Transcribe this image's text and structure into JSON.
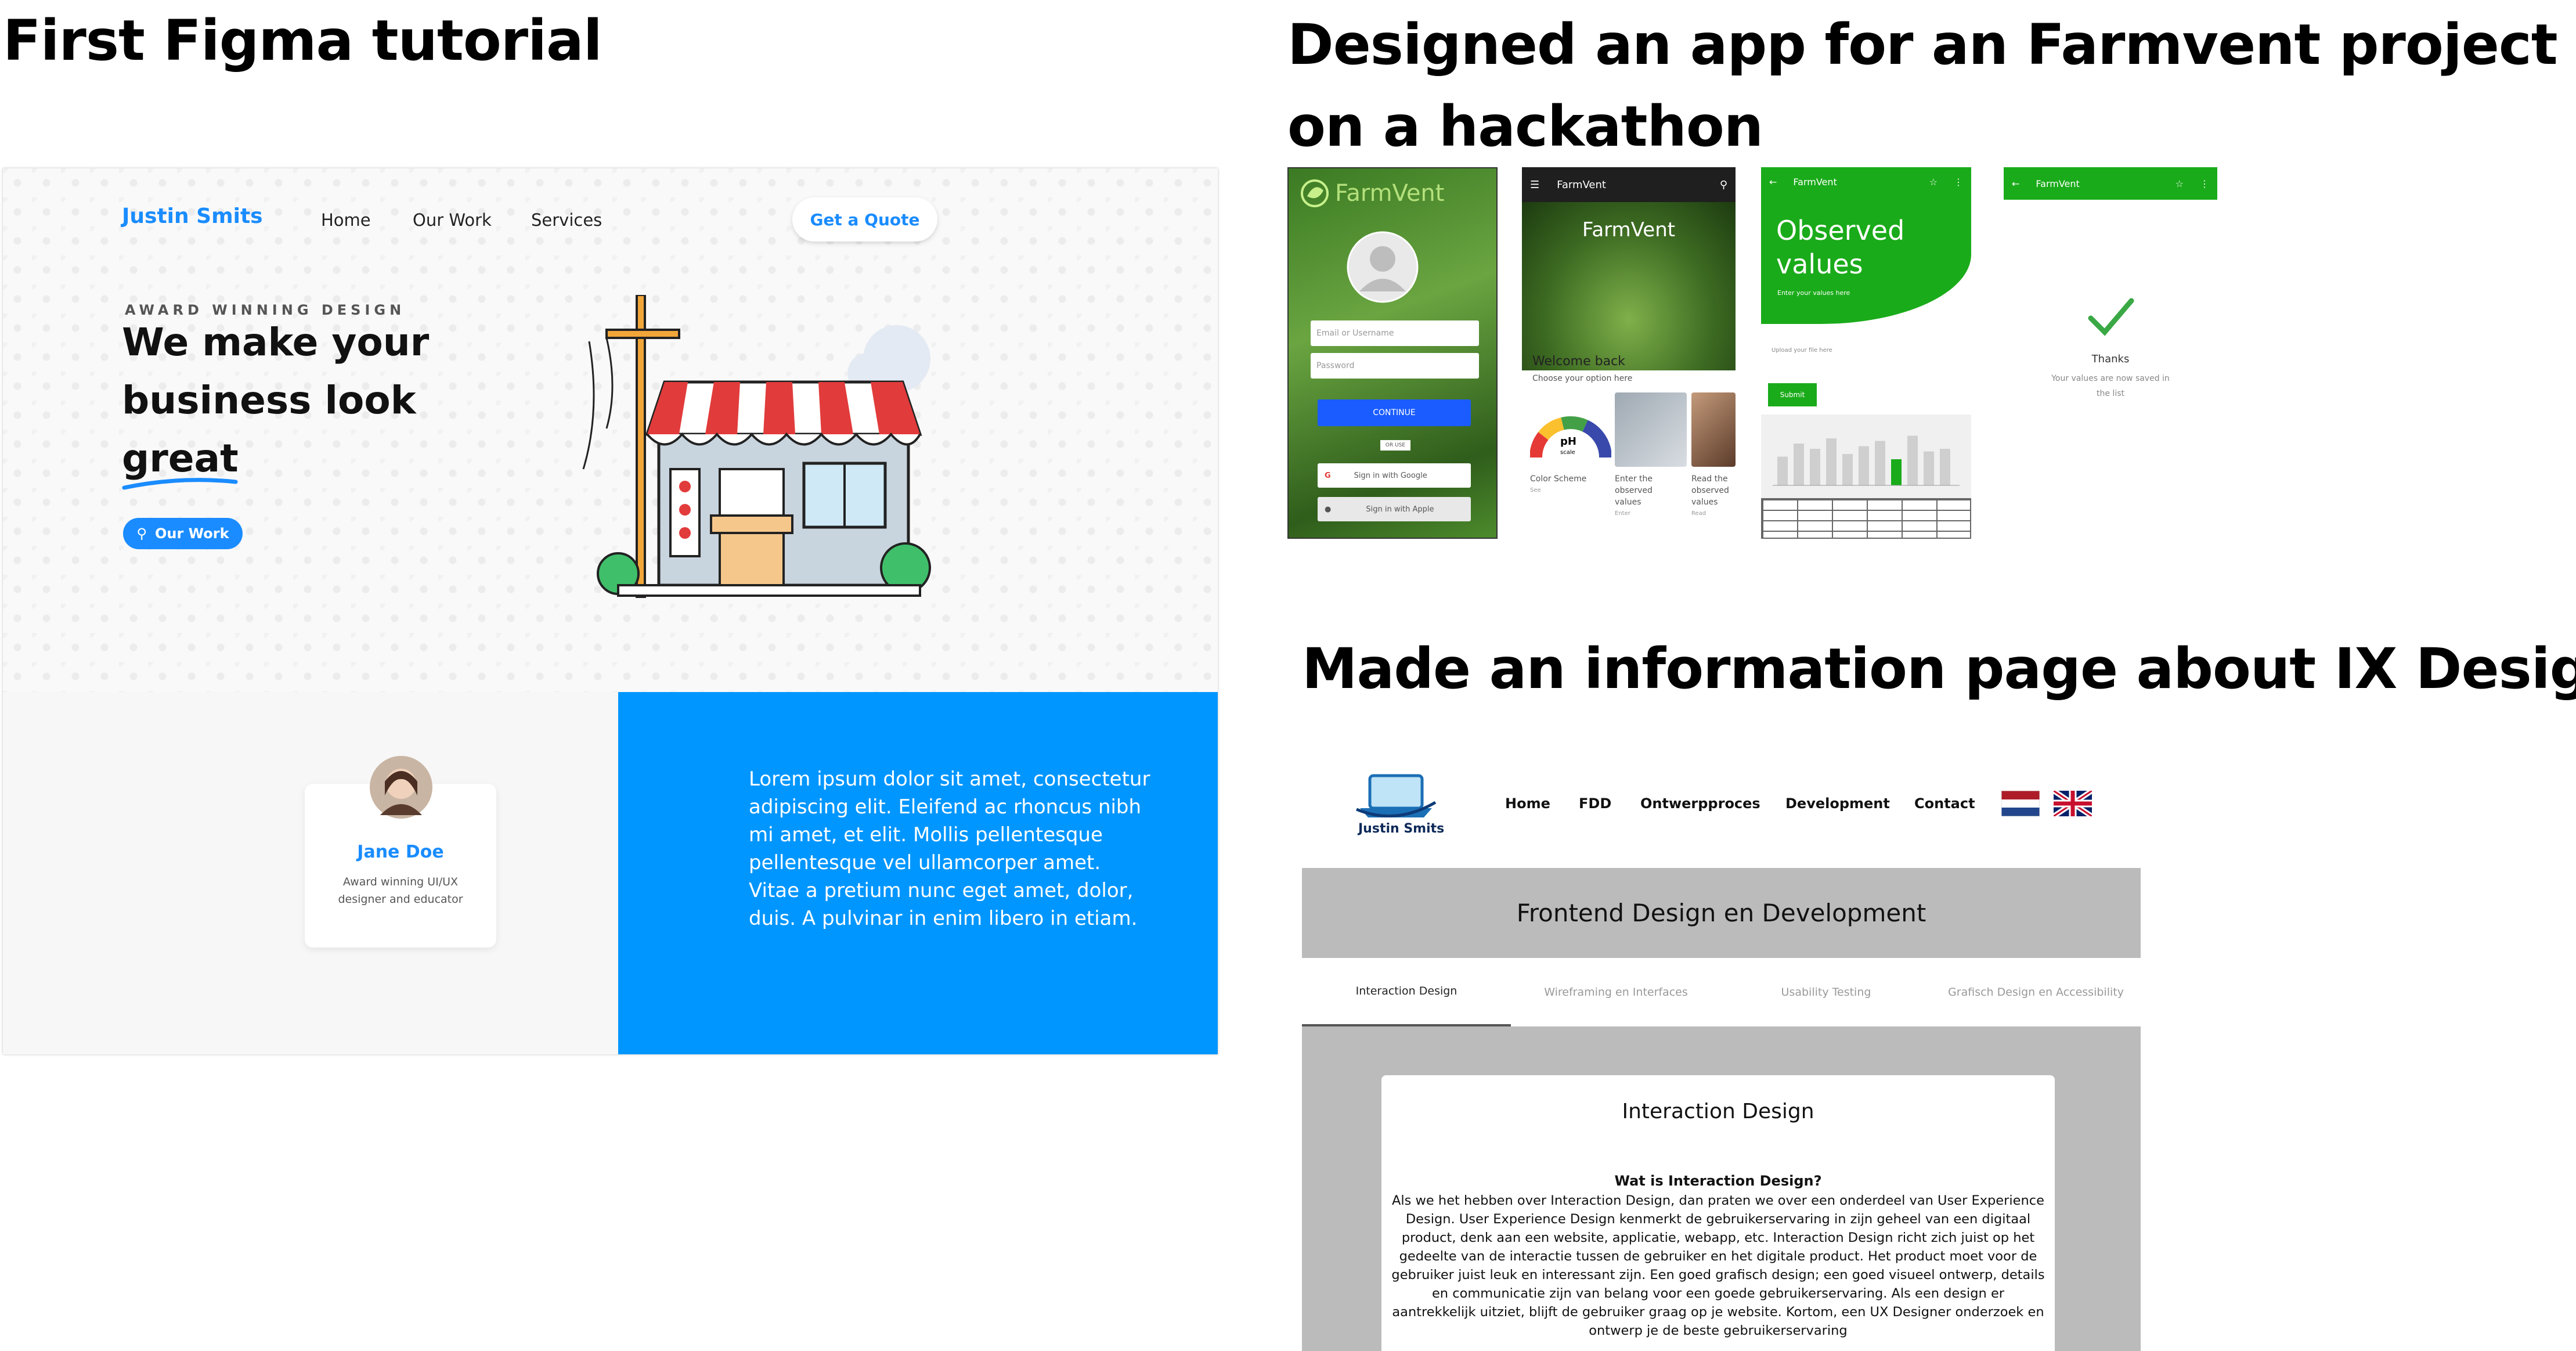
{
  "headings": {
    "figma": "First Figma tutorial",
    "farmvent_line1": "Designed an app for an Farmvent project",
    "farmvent_line2": "on a hackathon",
    "ix": "Made an information page about IX Design"
  },
  "figma": {
    "brand": "Justin Smits",
    "nav": [
      "Home",
      "Our Work",
      "Services"
    ],
    "quote_button": "Get a Quote",
    "overline": "AWARD WINNING DESIGN",
    "hero_lines": [
      "We make your",
      "business look",
      "great"
    ],
    "ourwork_button": "Our Work",
    "profile": {
      "name": "Jane Doe",
      "role_line1": "Award winning UI/UX",
      "role_line2": "designer and educator"
    },
    "lorem_lines": [
      "Lorem ipsum dolor sit amet, consectetur",
      "adipiscing elit. Eleifend ac rhoncus nibh",
      "mi amet, et elit. Mollis pellentesque",
      "pellentesque vel ullamcorper amet.",
      "Vitae a pretium nunc eget amet, dolor,",
      "duis. A pulvinar in enim libero in etiam."
    ],
    "colors": {
      "accent": "#1a8cff",
      "panel": "#0096ff"
    }
  },
  "farmvent": {
    "login": {
      "logo": "FarmVent",
      "email_placeholder": "Email or Username",
      "password_placeholder": "Password",
      "continue": "CONTINUE",
      "or": "OR USE",
      "google": "Sign in with Google",
      "apple": "Sign in with Apple"
    },
    "home": {
      "appbar": "FarmVent",
      "hero_title": "FarmVent",
      "welcome": "Welcome back",
      "choose": "Choose your option here",
      "options": [
        {
          "label1": "Color Scheme",
          "label2": "",
          "label3": "",
          "sub": "See"
        },
        {
          "label1": "Enter the",
          "label2": "observed",
          "label3": "values",
          "sub": "Enter"
        },
        {
          "label1": "Read the",
          "label2": "observed",
          "label3": "values",
          "sub": "Read"
        }
      ],
      "ph_label": "pH",
      "ph_scale": "scale"
    },
    "observed": {
      "appbar": "FarmVent",
      "title_line1": "Observed",
      "title_line2": "values",
      "subtitle": "Enter your values here",
      "upload": "Upload your file here",
      "submit": "Submit",
      "chart_bars": [
        0.55,
        0.8,
        0.7,
        0.9,
        0.6,
        0.75,
        0.85,
        0.5,
        0.95,
        0.65,
        0.7
      ],
      "chart_highlight_index": 7
    },
    "thanks": {
      "appbar": "FarmVent",
      "title": "Thanks",
      "line1": "Your values are now saved in",
      "line2": "the list"
    },
    "colors": {
      "green": "#1aab1a"
    }
  },
  "ix": {
    "brand": "Justin Smits",
    "nav": [
      "Home",
      "FDD",
      "Ontwerpproces",
      "Development",
      "Contact"
    ],
    "banner": "Frontend Design en Development",
    "tabs": [
      "Interaction Design",
      "Wireframing en Interfaces",
      "Usability Testing",
      "Grafisch Design en Accessibility"
    ],
    "card_title": "Interaction Design",
    "question": "Wat is Interaction Design?",
    "body_lines": [
      "Als we het hebben over Interaction Design, dan praten we over een onderdeel van User Experience",
      "Design. User Experience Design kenmerkt de gebruikerservaring in zijn geheel van een digitaal",
      "product, denk aan een website, applicatie, webapp, etc. Interaction Design richt zich juist op het",
      "gedeelte van de interactie tussen de gebruiker en het digitale product. Het product moet voor de",
      "gebruiker juist leuk en interessant zijn. Een goed grafisch design; een goed visueel ontwerp, details",
      "en communicatie zijn van belang voor een goede gebruikerservaring. Als een design er",
      "aantrekkelijk uitziet, blijft de gebruiker graag op je website. Kortom, een UX Designer onderzoek en",
      "ontwerp je de beste gebruikerservaring"
    ]
  }
}
